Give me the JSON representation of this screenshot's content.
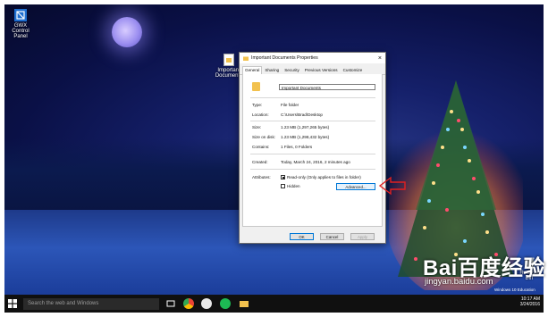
{
  "desktop": {
    "icons": [
      {
        "label": "GWX Control Panel"
      },
      {
        "label": "Important Documents"
      },
      {
        "label": "Recycle Bin"
      }
    ]
  },
  "dialog": {
    "title": "Important Documents Properties",
    "tabs": [
      "General",
      "Sharing",
      "Security",
      "Previous Versions",
      "Customize"
    ],
    "active_tab": "General",
    "name_value": "Important Documents",
    "fields": [
      {
        "label": "Type:",
        "value": "File folder"
      },
      {
        "label": "Location:",
        "value": "C:\\Users\\Brad\\Desktop"
      },
      {
        "label": "Size:",
        "value": "1.23 MB (1,297,265 bytes)"
      },
      {
        "label": "Size on disk:",
        "value": "1.23 MB (1,298,432 bytes)"
      },
      {
        "label": "Contains:",
        "value": "1 Files, 0 Folders"
      }
    ],
    "created": {
      "label": "Created:",
      "value": "Today, March 24, 2016, 2 minutes ago"
    },
    "attributes_label": "Attributes:",
    "readonly_label": "Read-only (Only applies to files in folder)",
    "readonly_checked": true,
    "hidden_label": "Hidden",
    "hidden_checked": false,
    "advanced_label": "Advanced...",
    "ok_label": "OK",
    "cancel_label": "Cancel",
    "apply_label": "Apply"
  },
  "taskbar": {
    "search_placeholder": "Search the web and Windows",
    "time": "10:17 AM",
    "date": "3/24/2016"
  },
  "overlay": {
    "watermark": "Bai百度经验",
    "watermark_url": "jingyan.baidu.com",
    "edition_text": "Windows 10 Education"
  },
  "colors": {
    "accent": "#0078d7",
    "folder": "#f2c14e",
    "arrow": "#e02020"
  }
}
